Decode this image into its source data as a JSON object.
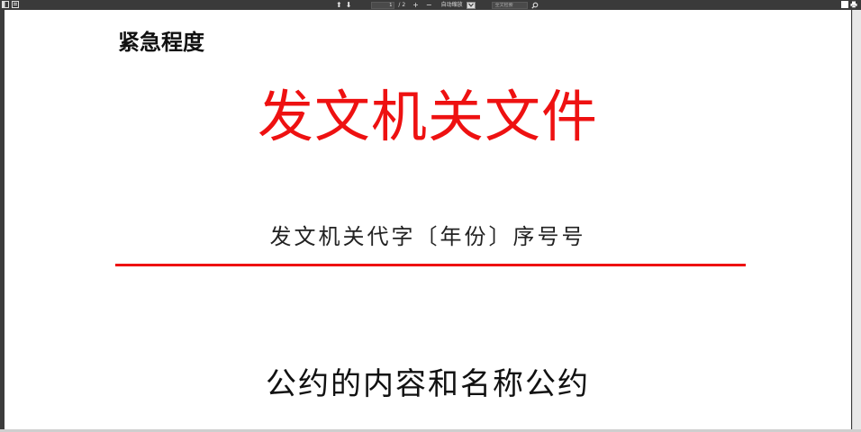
{
  "toolbar": {
    "icons": {
      "left": [
        "sidebar-toggle-icon",
        "document-outline-icon"
      ],
      "right": [
        "presentation-icon",
        "print-icon"
      ]
    },
    "page_current": "1",
    "page_total": "/ 2",
    "zoom_in": "+",
    "zoom_out": "−",
    "zoom_label": "自动缩放",
    "search_placeholder": "全文检索"
  },
  "document": {
    "urgency_label": "紧急程度",
    "issuing_authority": "发文机关文件",
    "document_number": "发文机关代字〔年份〕序号号",
    "title": "公约的内容和名称公约"
  },
  "colors": {
    "red_header": "#ee1111",
    "toolbar_bg": "#3a3a3a"
  }
}
